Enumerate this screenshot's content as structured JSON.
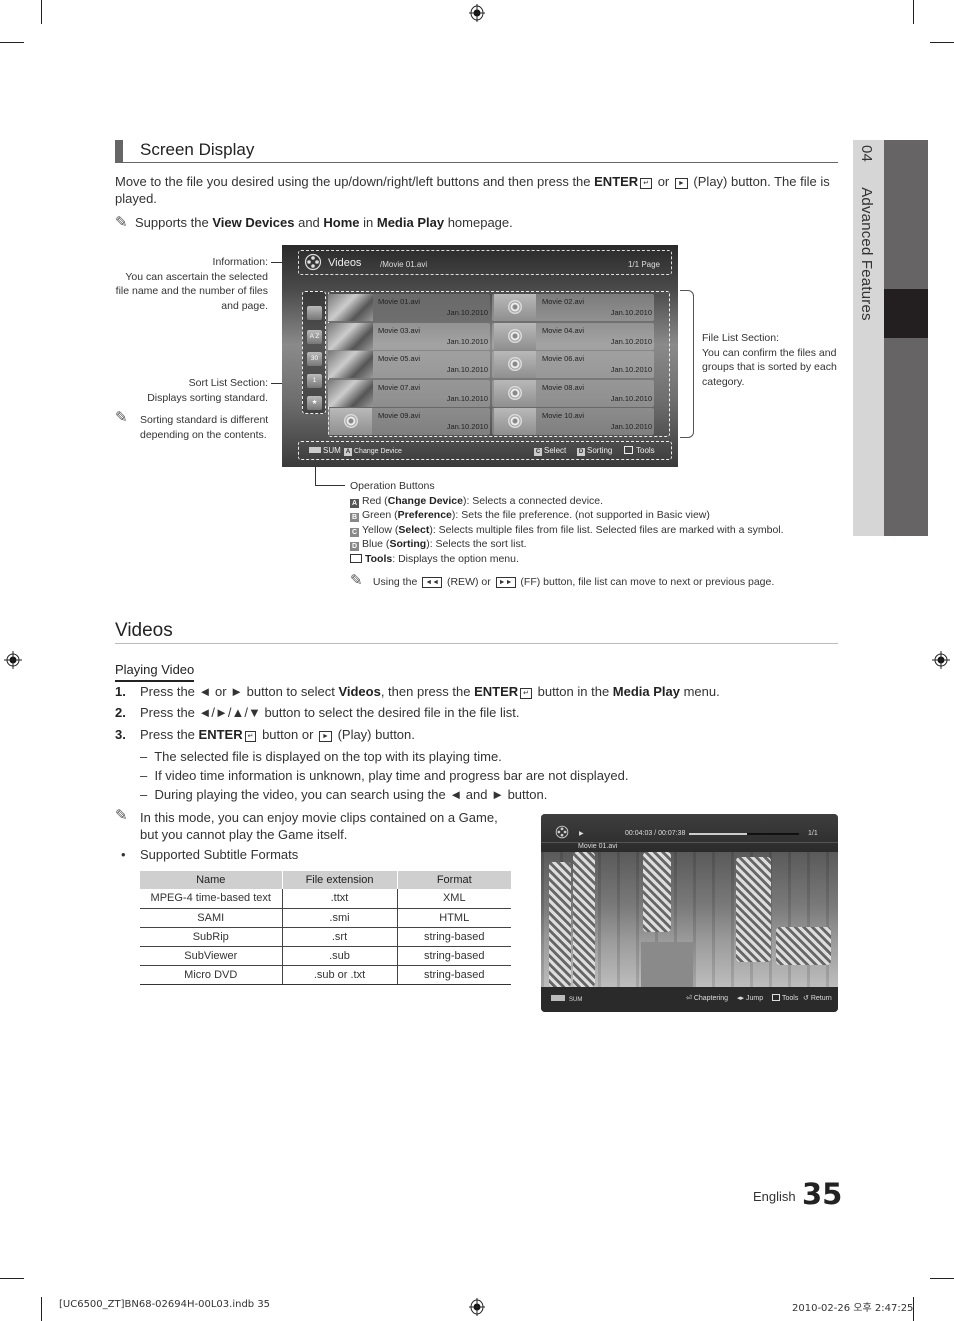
{
  "side_tab": {
    "chapter_number": "04",
    "chapter_title": "Advanced Features"
  },
  "screen_display": {
    "heading": "Screen Display",
    "intro_part1": "Move to the file you desired using the up/down/right/left buttons and then press the ",
    "intro_enter": "ENTER",
    "intro_part2": " or ",
    "intro_play_symbol": "►",
    "intro_part3": " (Play) button. The file is played.",
    "note_prefix": "Supports the ",
    "note_view_devices": "View Devices",
    "note_and": " and ",
    "note_home": "Home",
    "note_in": " in ",
    "note_media_play": "Media Play",
    "note_suffix": " homepage."
  },
  "callouts": {
    "information_title": "Information:",
    "information_desc": "You can ascertain the selected file name and the number of files and page.",
    "sort_title": "Sort List Section:",
    "sort_desc": "Displays sorting standard.",
    "sort_note": "Sorting standard is different depending on the contents.",
    "file_list_title": "File List Section:",
    "file_list_desc": "You can confirm the files and groups that is sorted by each category."
  },
  "tv_file_browser": {
    "category": "Videos",
    "path": "/Movie 01.avi",
    "page": "1/1 Page",
    "sort_icons": [
      "folder-icon",
      "alphabet-sort-icon",
      "date-30-icon",
      "calendar-icon",
      "favorite-star-icon"
    ],
    "sort_labels": [
      "",
      "A Z",
      "30",
      "1",
      "★"
    ],
    "files": [
      {
        "name": "Movie 01.avi",
        "date": "Jan.10.2010",
        "thumb": "photo",
        "selected": true
      },
      {
        "name": "Movie 02.avi",
        "date": "Jan.10.2010",
        "thumb": "reel",
        "selected": false
      },
      {
        "name": "Movie 03.avi",
        "date": "Jan.10.2010",
        "thumb": "photo",
        "selected": false
      },
      {
        "name": "Movie 04.avi",
        "date": "Jan.10.2010",
        "thumb": "reel",
        "selected": false
      },
      {
        "name": "Movie 05.avi",
        "date": "Jan.10.2010",
        "thumb": "photo",
        "selected": false
      },
      {
        "name": "Movie 06.avi",
        "date": "Jan.10.2010",
        "thumb": "reel",
        "selected": false
      },
      {
        "name": "Movie 07.avi",
        "date": "Jan.10.2010",
        "thumb": "photo",
        "selected": false
      },
      {
        "name": "Movie 08.avi",
        "date": "Jan.10.2010",
        "thumb": "reel",
        "selected": false
      },
      {
        "name": "Movie 09.avi",
        "date": "Jan.10.2010",
        "thumb": "reel",
        "selected": false
      },
      {
        "name": "Movie 10.avi",
        "date": "Jan.10.2010",
        "thumb": "reel",
        "selected": false
      }
    ],
    "footer": {
      "sum": "SUM",
      "key_a": "A",
      "change_device": "Change Device",
      "key_c": "C",
      "select": "Select",
      "key_d": "D",
      "sorting": "Sorting",
      "tools": "Tools"
    }
  },
  "operation_buttons": {
    "title": "Operation Buttons",
    "items": [
      {
        "key": "A",
        "color": "Red",
        "name": "Change Device",
        "desc": ": Selects a connected device."
      },
      {
        "key": "B",
        "color": "Green",
        "name": "Preference",
        "desc": ": Sets the file preference. (not supported in Basic view)"
      },
      {
        "key": "C",
        "color": "Yellow",
        "name": "Select",
        "desc": ": Selects multiple files from file list. Selected files are marked with a symbol."
      },
      {
        "key": "D",
        "color": "Blue",
        "name": "Sorting",
        "desc": ": Selects the sort list."
      }
    ],
    "tools_name": "Tools",
    "tools_desc": ": Displays the option menu.",
    "note_part1": "Using the ",
    "note_rew": "◄◄",
    "note_part2": " (REW) or ",
    "note_ff": "►►",
    "note_part3": " (FF) button, file list can move to next or previous page."
  },
  "videos": {
    "heading": "Videos",
    "subheading": "Playing Video",
    "steps": [
      {
        "n": "1.",
        "parts": [
          "Press the ◄ or ► button to select ",
          "Videos",
          ", then press the ",
          "ENTER",
          " button in the ",
          "Media Play",
          " menu."
        ]
      },
      {
        "n": "2.",
        "text": "Press the ◄/►/▲/▼ button to select the desired file in the file list."
      },
      {
        "n": "3.",
        "parts": [
          "Press the ",
          "ENTER",
          " button or ",
          "►",
          " (Play) button."
        ]
      }
    ],
    "dashes": [
      "The selected file is displayed on the top with its playing time.",
      "If video time information is unknown, play time and progress bar are not displayed.",
      "During playing the video, you can search using the ◄ and ► button."
    ],
    "note": "In this mode, you can enjoy movie clips contained on a Game, but you cannot play the Game itself.",
    "bullet": "Supported Subtitle Formats",
    "table": {
      "headers": [
        "Name",
        "File extension",
        "Format"
      ],
      "rows": [
        [
          "MPEG-4 time-based text",
          ".ttxt",
          "XML"
        ],
        [
          "SAMI",
          ".smi",
          "HTML"
        ],
        [
          "SubRip",
          ".srt",
          "string-based"
        ],
        [
          "SubViewer",
          ".sub",
          "string-based"
        ],
        [
          "Micro DVD",
          ".sub or .txt",
          "string-based"
        ]
      ]
    }
  },
  "tv_player": {
    "time": "00:04:03 / 00:07:38",
    "progress_fraction": 0.53,
    "count": "1/1",
    "file_name": "Movie 01.avi",
    "sum": "SUM",
    "chaptering": "Chaptering",
    "jump": "Jump",
    "tools": "Tools",
    "return": "Return"
  },
  "page_footer": {
    "language": "English",
    "page_number": "35"
  },
  "print_info": {
    "file": "[UC6500_ZT]BN68-02694H-00L03.indb   35",
    "timestamp": "2010-02-26   오후 2:47:25"
  }
}
